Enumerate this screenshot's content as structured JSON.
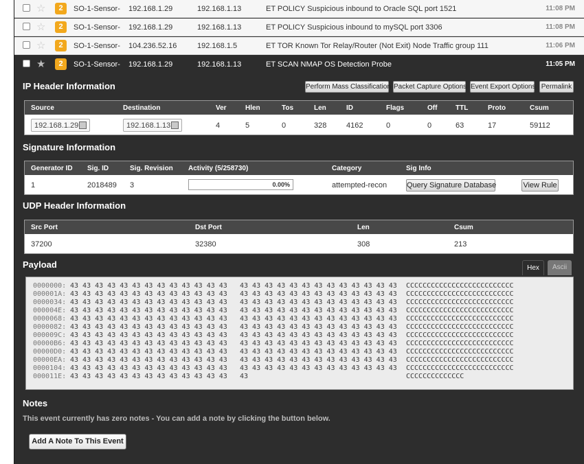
{
  "events": [
    {
      "priority": "2",
      "sensor": "SO-1-Sensor-",
      "src_ip": "192.168.1.29",
      "dst_ip": "192.168.1.13",
      "signature": "ET POLICY Suspicious inbound to Oracle SQL port 1521",
      "time": "11:08 PM"
    },
    {
      "priority": "2",
      "sensor": "SO-1-Sensor-",
      "src_ip": "192.168.1.29",
      "dst_ip": "192.168.1.13",
      "signature": "ET POLICY Suspicious inbound to mySQL port 3306",
      "time": "11:08 PM"
    },
    {
      "priority": "2",
      "sensor": "SO-1-Sensor-",
      "src_ip": "104.236.52.16",
      "dst_ip": "192.168.1.5",
      "signature": "ET TOR Known Tor Relay/Router (Not Exit) Node Traffic group 111",
      "time": "11:06 PM"
    },
    {
      "priority": "2",
      "sensor": "SO-1-Sensor-",
      "src_ip": "192.168.1.29",
      "dst_ip": "192.168.1.13",
      "signature": "ET SCAN NMAP OS Detection Probe",
      "time": "11:05 PM"
    }
  ],
  "icons": {
    "checkbox": "checkbox-icon",
    "star": "star-icon"
  },
  "ip_header": {
    "title": "IP Header Information",
    "buttons": [
      "Perform Mass Classification",
      "Packet Capture Options",
      "Event Export Options",
      "Permalink"
    ],
    "columns": [
      "Source",
      "Destination",
      "Ver",
      "Hlen",
      "Tos",
      "Len",
      "ID",
      "Flags",
      "Off",
      "TTL",
      "Proto",
      "Csum"
    ],
    "values": {
      "source": "192.168.1.29",
      "destination": "192.168.1.13",
      "ver": "4",
      "hlen": "5",
      "tos": "0",
      "len": "328",
      "id": "4162",
      "flags": "0",
      "off": "0",
      "ttl": "63",
      "proto": "17",
      "csum": "59112"
    }
  },
  "signature": {
    "title": "Signature Information",
    "columns": [
      "Generator ID",
      "Sig. ID",
      "Sig. Revision",
      "Activity (5/258730)",
      "Category",
      "Sig Info"
    ],
    "values": {
      "generator_id": "1",
      "sig_id": "2018489",
      "sig_revision": "3",
      "activity": "0.00%",
      "activity_fraction": 0.0,
      "category": "attempted-recon"
    },
    "buttons": {
      "query": "Query Signature Database",
      "view_rule": "View Rule"
    }
  },
  "udp_header": {
    "title": "UDP Header Information",
    "columns": [
      "Src Port",
      "Dst Port",
      "Len",
      "Csum"
    ],
    "values": {
      "src_port": "37200",
      "dst_port": "32380",
      "len": "308",
      "csum": "213"
    }
  },
  "payload": {
    "title": "Payload",
    "tabs": [
      "Hex",
      "Ascii"
    ],
    "active_tab": "Hex",
    "lines": [
      {
        "offset": "0000000:",
        "hex1": "43 43 43 43 43 43 43 43 43 43 43 43 43",
        "hex2": "43 43 43 43 43 43 43 43 43 43 43 43 43",
        "ascii": "CCCCCCCCCCCCCCCCCCCCCCCCCC"
      },
      {
        "offset": "000001A:",
        "hex1": "43 43 43 43 43 43 43 43 43 43 43 43 43",
        "hex2": "43 43 43 43 43 43 43 43 43 43 43 43 43",
        "ascii": "CCCCCCCCCCCCCCCCCCCCCCCCCC"
      },
      {
        "offset": "0000034:",
        "hex1": "43 43 43 43 43 43 43 43 43 43 43 43 43",
        "hex2": "43 43 43 43 43 43 43 43 43 43 43 43 43",
        "ascii": "CCCCCCCCCCCCCCCCCCCCCCCCCC"
      },
      {
        "offset": "000004E:",
        "hex1": "43 43 43 43 43 43 43 43 43 43 43 43 43",
        "hex2": "43 43 43 43 43 43 43 43 43 43 43 43 43",
        "ascii": "CCCCCCCCCCCCCCCCCCCCCCCCCC"
      },
      {
        "offset": "0000068:",
        "hex1": "43 43 43 43 43 43 43 43 43 43 43 43 43",
        "hex2": "43 43 43 43 43 43 43 43 43 43 43 43 43",
        "ascii": "CCCCCCCCCCCCCCCCCCCCCCCCCC"
      },
      {
        "offset": "0000082:",
        "hex1": "43 43 43 43 43 43 43 43 43 43 43 43 43",
        "hex2": "43 43 43 43 43 43 43 43 43 43 43 43 43",
        "ascii": "CCCCCCCCCCCCCCCCCCCCCCCCCC"
      },
      {
        "offset": "000009C:",
        "hex1": "43 43 43 43 43 43 43 43 43 43 43 43 43",
        "hex2": "43 43 43 43 43 43 43 43 43 43 43 43 43",
        "ascii": "CCCCCCCCCCCCCCCCCCCCCCCCCC"
      },
      {
        "offset": "00000B6:",
        "hex1": "43 43 43 43 43 43 43 43 43 43 43 43 43",
        "hex2": "43 43 43 43 43 43 43 43 43 43 43 43 43",
        "ascii": "CCCCCCCCCCCCCCCCCCCCCCCCCC"
      },
      {
        "offset": "00000D0:",
        "hex1": "43 43 43 43 43 43 43 43 43 43 43 43 43",
        "hex2": "43 43 43 43 43 43 43 43 43 43 43 43 43",
        "ascii": "CCCCCCCCCCCCCCCCCCCCCCCCCC"
      },
      {
        "offset": "00000EA:",
        "hex1": "43 43 43 43 43 43 43 43 43 43 43 43 43",
        "hex2": "43 43 43 43 43 43 43 43 43 43 43 43 43",
        "ascii": "CCCCCCCCCCCCCCCCCCCCCCCCCC"
      },
      {
        "offset": "0000104:",
        "hex1": "43 43 43 43 43 43 43 43 43 43 43 43 43",
        "hex2": "43 43 43 43 43 43 43 43 43 43 43 43 43",
        "ascii": "CCCCCCCCCCCCCCCCCCCCCCCCCC"
      },
      {
        "offset": "000011E:",
        "hex1": "43 43 43 43 43 43 43 43 43 43 43 43 43",
        "hex2": "43",
        "ascii": "CCCCCCCCCCCCCC"
      }
    ]
  },
  "notes": {
    "title": "Notes",
    "text": "This event currently has zero notes - You can add a note by clicking the button below.",
    "add_button": "Add A Note To This Event"
  },
  "colors": {
    "priority_badge": "#f2a81d",
    "panel_dark": "#2d2d2d",
    "table_header": "#484848"
  }
}
